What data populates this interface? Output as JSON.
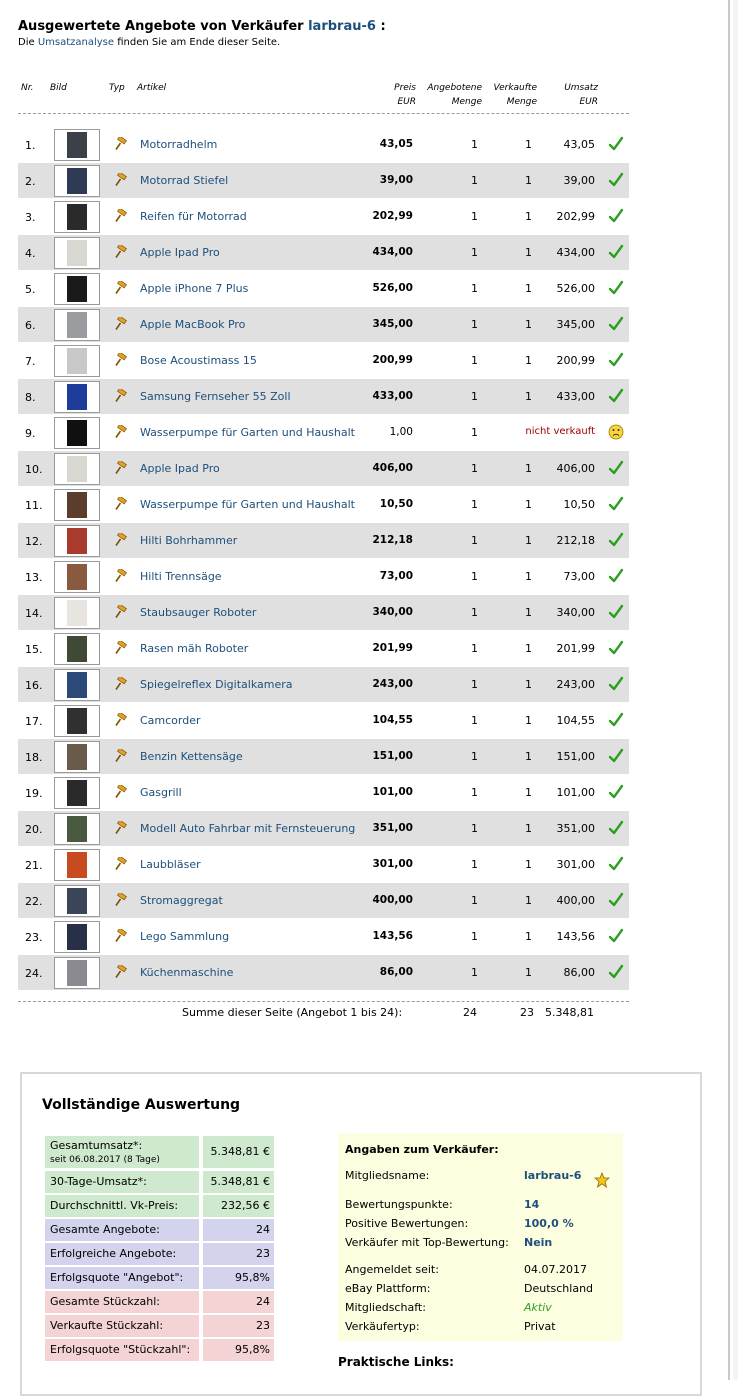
{
  "header": {
    "title_prefix": "Ausgewertete Angebote von Verkäufer",
    "seller": "larbrau-6",
    "title_suffix": ":",
    "sub_prefix": "Die",
    "sub_link": "Umsatzanalyse",
    "sub_suffix": "finden Sie am Ende dieser Seite."
  },
  "columns": {
    "nr": "Nr.",
    "bild": "Bild",
    "typ": "Typ",
    "artikel": "Artikel",
    "preis": "Preis",
    "preis_unit": "EUR",
    "angebotene": "Angebotene",
    "angebotene_2": "Menge",
    "verkaufte": "Verkaufte",
    "verkaufte_2": "Menge",
    "umsatz": "Umsatz",
    "umsatz_unit": "EUR"
  },
  "rows": [
    {
      "nr": "1.",
      "article": "Motorradhelm",
      "price": "43,05",
      "offered": "1",
      "sold": "1",
      "revenue": "43,05",
      "status": "sold",
      "thumb": "#3c4048"
    },
    {
      "nr": "2.",
      "article": "Motorrad Stiefel",
      "price": "39,00",
      "offered": "1",
      "sold": "1",
      "revenue": "39,00",
      "status": "sold",
      "thumb": "#2f3a55"
    },
    {
      "nr": "3.",
      "article": "Reifen für Motorrad",
      "price": "202,99",
      "offered": "1",
      "sold": "1",
      "revenue": "202,99",
      "status": "sold",
      "thumb": "#2a2a2a"
    },
    {
      "nr": "4.",
      "article": "Apple Ipad Pro",
      "price": "434,00",
      "offered": "1",
      "sold": "1",
      "revenue": "434,00",
      "status": "sold",
      "thumb": "#d8d8d0"
    },
    {
      "nr": "5.",
      "article": "Apple iPhone 7 Plus",
      "price": "526,00",
      "offered": "1",
      "sold": "1",
      "revenue": "526,00",
      "status": "sold",
      "thumb": "#1a1a1a"
    },
    {
      "nr": "6.",
      "article": "Apple MacBook Pro",
      "price": "345,00",
      "offered": "1",
      "sold": "1",
      "revenue": "345,00",
      "status": "sold",
      "thumb": "#9a9ca0"
    },
    {
      "nr": "7.",
      "article": "Bose Acoustimass 15",
      "price": "200,99",
      "offered": "1",
      "sold": "1",
      "revenue": "200,99",
      "status": "sold",
      "thumb": "#c8c8c8"
    },
    {
      "nr": "8.",
      "article": "Samsung Fernseher 55 Zoll",
      "price": "433,00",
      "offered": "1",
      "sold": "1",
      "revenue": "433,00",
      "status": "sold",
      "thumb": "#1e3c9a"
    },
    {
      "nr": "9.",
      "article": "Wasserpumpe für Garten und Haushalt",
      "price": "1,00",
      "offered": "1",
      "sold": "",
      "revenue": "nicht verkauft",
      "status": "unsold",
      "thumb": "#101010"
    },
    {
      "nr": "10.",
      "article": "Apple Ipad Pro",
      "price": "406,00",
      "offered": "1",
      "sold": "1",
      "revenue": "406,00",
      "status": "sold",
      "thumb": "#d8d8d0"
    },
    {
      "nr": "11.",
      "article": "Wasserpumpe für Garten und Haushalt",
      "price": "10,50",
      "offered": "1",
      "sold": "1",
      "revenue": "10,50",
      "status": "sold",
      "thumb": "#5a3d2a"
    },
    {
      "nr": "12.",
      "article": "Hilti Bohrhammer",
      "price": "212,18",
      "offered": "1",
      "sold": "1",
      "revenue": "212,18",
      "status": "sold",
      "thumb": "#a83a2e"
    },
    {
      "nr": "13.",
      "article": "Hilti Trennsäge",
      "price": "73,00",
      "offered": "1",
      "sold": "1",
      "revenue": "73,00",
      "status": "sold",
      "thumb": "#8a5a40"
    },
    {
      "nr": "14.",
      "article": "Staubsauger Roboter",
      "price": "340,00",
      "offered": "1",
      "sold": "1",
      "revenue": "340,00",
      "status": "sold",
      "thumb": "#e8e4e0"
    },
    {
      "nr": "15.",
      "article": "Rasen mäh Roboter",
      "price": "201,99",
      "offered": "1",
      "sold": "1",
      "revenue": "201,99",
      "status": "sold",
      "thumb": "#3e4a36"
    },
    {
      "nr": "16.",
      "article": "Spiegelreflex Digitalkamera",
      "price": "243,00",
      "offered": "1",
      "sold": "1",
      "revenue": "243,00",
      "status": "sold",
      "thumb": "#2c4a78"
    },
    {
      "nr": "17.",
      "article": "Camcorder",
      "price": "104,55",
      "offered": "1",
      "sold": "1",
      "revenue": "104,55",
      "status": "sold",
      "thumb": "#303030"
    },
    {
      "nr": "18.",
      "article": "Benzin Kettensäge",
      "price": "151,00",
      "offered": "1",
      "sold": "1",
      "revenue": "151,00",
      "status": "sold",
      "thumb": "#6a5a4a"
    },
    {
      "nr": "19.",
      "article": "Gasgrill",
      "price": "101,00",
      "offered": "1",
      "sold": "1",
      "revenue": "101,00",
      "status": "sold",
      "thumb": "#2a2a2a"
    },
    {
      "nr": "20.",
      "article": "Modell Auto Fahrbar mit Fernsteuerung",
      "price": "351,00",
      "offered": "1",
      "sold": "1",
      "revenue": "351,00",
      "status": "sold",
      "thumb": "#4a5a40"
    },
    {
      "nr": "21.",
      "article": "Laubbläser",
      "price": "301,00",
      "offered": "1",
      "sold": "1",
      "revenue": "301,00",
      "status": "sold",
      "thumb": "#c84a20"
    },
    {
      "nr": "22.",
      "article": "Stromaggregat",
      "price": "400,00",
      "offered": "1",
      "sold": "1",
      "revenue": "400,00",
      "status": "sold",
      "thumb": "#3a4658"
    },
    {
      "nr": "23.",
      "article": "Lego Sammlung",
      "price": "143,56",
      "offered": "1",
      "sold": "1",
      "revenue": "143,56",
      "status": "sold",
      "thumb": "#283048"
    },
    {
      "nr": "24.",
      "article": "Küchenmaschine",
      "price": "86,00",
      "offered": "1",
      "sold": "1",
      "revenue": "86,00",
      "status": "sold",
      "thumb": "#8a8a90"
    }
  ],
  "summary": {
    "label": "Summe dieser Seite (Angebot 1 bis 24):",
    "offered": "24",
    "sold": "23",
    "revenue": "5.348,81"
  },
  "full": {
    "title": "Vollständige Auswertung",
    "stats": [
      {
        "label": "Gesamtumsatz*:",
        "sub": "seit 06.08.2017 (8 Tage)",
        "value": "5.348,81 €",
        "group": "g"
      },
      {
        "label": "30-Tage-Umsatz*:",
        "value": "5.348,81 €",
        "group": "g"
      },
      {
        "label": "Durchschnittl. Vk-Preis:",
        "value": "232,56 €",
        "group": "g"
      },
      {
        "label": "Gesamte Angebote:",
        "value": "24",
        "group": "b"
      },
      {
        "label": "Erfolgreiche Angebote:",
        "value": "23",
        "group": "b"
      },
      {
        "label": "Erfolgsquote \"Angebot\":",
        "value": "95,8%",
        "group": "b"
      },
      {
        "label": "Gesamte Stückzahl:",
        "value": "24",
        "group": "r"
      },
      {
        "label": "Verkaufte Stückzahl:",
        "value": "23",
        "group": "r"
      },
      {
        "label": "Erfolgsquote \"Stückzahl\":",
        "value": "95,8%",
        "group": "r"
      }
    ]
  },
  "seller_info": {
    "title": "Angaben zum Verkäufer:",
    "member_label": "Mitgliedsname:",
    "member_value": "larbrau-6",
    "points_label": "Bewertungspunkte:",
    "points_value": "14",
    "positive_label": "Positive Bewertungen:",
    "positive_value": "100,0 %",
    "top_label": "Verkäufer mit Top-Bewertung:",
    "top_value": "Nein",
    "since_label": "Angemeldet seit:",
    "since_value": "04.07.2017",
    "platform_label": "eBay Plattform:",
    "platform_value": "Deutschland",
    "membership_label": "Mitgliedschaft:",
    "membership_value": "Aktiv",
    "type_label": "Verkäufertyp:",
    "type_value": "Privat"
  },
  "links_title": "Praktische Links:",
  "colors": {
    "link": "#1d4f7c",
    "row_alt": "#e0e0e0",
    "check": "#2e9e22",
    "unsold": "#a00000",
    "green_bg": "#cfe9cf",
    "blue_bg": "#d3d3ee",
    "red_bg": "#f3d3d3",
    "seller_bg": "#fdfde0"
  },
  "icons": {
    "type": "auction-hammer-icon",
    "sold": "checkmark-icon",
    "unsold": "sad-smiley-icon",
    "member": "star-icon"
  }
}
